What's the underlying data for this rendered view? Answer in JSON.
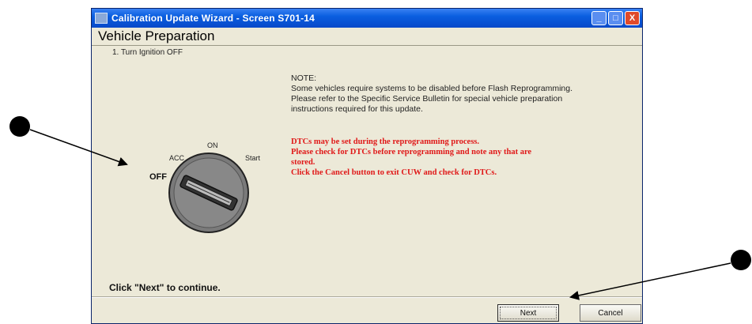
{
  "window": {
    "title": "Calibration Update Wizard - Screen S701-14",
    "controls": {
      "minimize": "_",
      "maximize": "□",
      "close": "X"
    }
  },
  "page": {
    "heading": "Vehicle Preparation"
  },
  "instructions": {
    "step1": "1. Turn Ignition OFF"
  },
  "ignition": {
    "positions": {
      "acc": "ACC",
      "on": "ON",
      "start": "Start",
      "off": "OFF"
    }
  },
  "note": {
    "label": "NOTE:",
    "line1": "Some vehicles require systems to be disabled before Flash Reprogramming.",
    "line2": "Please refer to the Specific Service Bulletin for special vehicle preparation",
    "line3": "instructions required for this update."
  },
  "warning": {
    "line1": "DTCs may be set during the reprogramming process.",
    "line2": "Please check for DTCs before reprogramming and note any that are",
    "line3": "stored.",
    "line4": "Click the Cancel button to exit CUW and check for DTCs."
  },
  "footer": {
    "continue_text": "Click \"Next\" to continue."
  },
  "buttons": {
    "next": "Next",
    "cancel": "Cancel"
  },
  "colors": {
    "titlebar": "#0a5ee0",
    "warning_text": "#e01818",
    "window_bg": "#ece9d8"
  }
}
